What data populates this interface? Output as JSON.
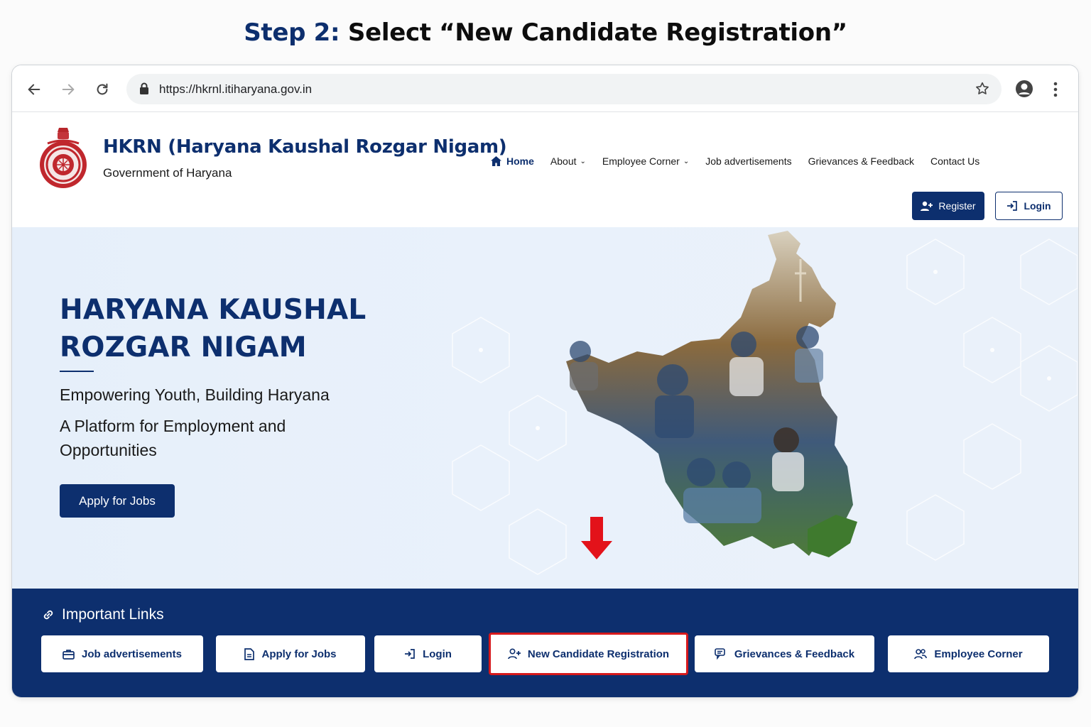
{
  "step": {
    "label": "Step 2:",
    "text": "Select “New Candidate Registration”"
  },
  "browser": {
    "url": "https://hkrnl.itiharyana.gov.in",
    "icons": [
      "back-arrow-icon",
      "forward-arrow-icon",
      "reload-icon",
      "lock-icon",
      "star-icon",
      "profile-icon",
      "kebab-menu-icon"
    ]
  },
  "header": {
    "org_name": "HKRN (Haryana Kaushal Rozgar Nigam)",
    "org_sub": "Government of Haryana",
    "nav": [
      "Home",
      "About",
      "Employee Corner",
      "Job advertisements",
      "Grievances & Feedback",
      "Contact Us"
    ],
    "register": "Register",
    "login": "Login"
  },
  "hero": {
    "title_line1": "HARYANA KAUSHAL",
    "title_line2": "ROZGAR NIGAM",
    "tagline": "Empowering Youth, Building Haryana",
    "description": "A Platform for Employment and Opportunities",
    "apply_button": "Apply for Jobs"
  },
  "important_links": {
    "title": "Important Links",
    "items": [
      {
        "label": "Job advertisements",
        "icon": "briefcase-icon"
      },
      {
        "label": "Apply for Jobs",
        "icon": "document-icon"
      },
      {
        "label": "Login",
        "icon": "login-icon"
      },
      {
        "label": "New Candidate Registration",
        "icon": "user-plus-icon",
        "highlighted": true
      },
      {
        "label": "Grievances & Feedback",
        "icon": "chat-icon"
      },
      {
        "label": "Employee Corner",
        "icon": "users-icon"
      }
    ]
  },
  "colors": {
    "primary": "#0d2f6e",
    "highlight": "#d6191c",
    "hero_bg": "#e8f0fa"
  }
}
